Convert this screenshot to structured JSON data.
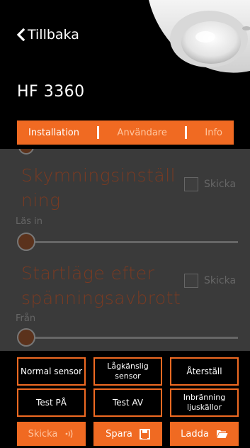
{
  "header": {
    "back_label": "Tillbaka",
    "title": "HF 3360"
  },
  "tabs": [
    {
      "label": "Installation",
      "active": true
    },
    {
      "label": "Användare",
      "active": false
    },
    {
      "label": "Info",
      "active": false
    }
  ],
  "content": {
    "section1": {
      "title_line1": "Skymningsinställ",
      "title_line2": "ning",
      "send_label": "Skicka",
      "value_label": "Läs in",
      "slider_value": 0
    },
    "section2": {
      "title_line1": "Startläge efter",
      "title_line2": "spänningsavbrott",
      "send_label": "Skicka",
      "value_label": "Från",
      "slider_value": 0
    }
  },
  "presets": {
    "normal_sensor": "Normal sensor",
    "low_sensitive_line1": "Lågkänslig",
    "low_sensitive_line2": "sensor",
    "reset": "Återställ",
    "test_on": "Test PÅ",
    "test_off": "Test AV",
    "burn_in_line1": "Inbränning",
    "burn_in_line2": "ljuskällor"
  },
  "actions": {
    "send": "Skicka",
    "save": "Spara",
    "load": "Ladda"
  },
  "colors": {
    "accent": "#f06a22",
    "background": "#000000",
    "dimmed_panel": "#3a3a3a"
  }
}
